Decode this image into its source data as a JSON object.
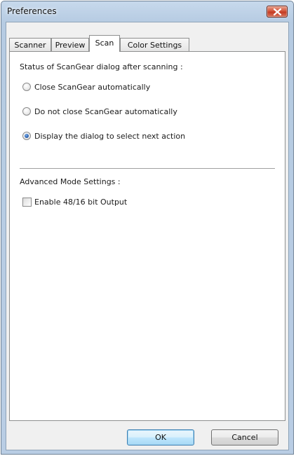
{
  "window": {
    "title": "Preferences"
  },
  "tabs": [
    {
      "label": "Scanner"
    },
    {
      "label": "Preview"
    },
    {
      "label": "Scan"
    },
    {
      "label": "Color Settings"
    }
  ],
  "active_tab": "Scan",
  "scan": {
    "status_heading": "Status of ScanGear dialog after scanning :",
    "options": [
      {
        "label": "Close ScanGear automatically",
        "selected": false
      },
      {
        "label": "Do not close ScanGear automatically",
        "selected": false
      },
      {
        "label": "Display the dialog to select next action",
        "selected": true
      }
    ],
    "advanced_heading": "Advanced Mode Settings :",
    "enable_48_16": {
      "label": "Enable 48/16 bit Output",
      "checked": false
    }
  },
  "buttons": {
    "ok": "OK",
    "cancel": "Cancel"
  },
  "colors": {
    "title_bar": "#b9cde4",
    "close_button": "#c43a22",
    "default_button_border": "#3c7fb1"
  }
}
